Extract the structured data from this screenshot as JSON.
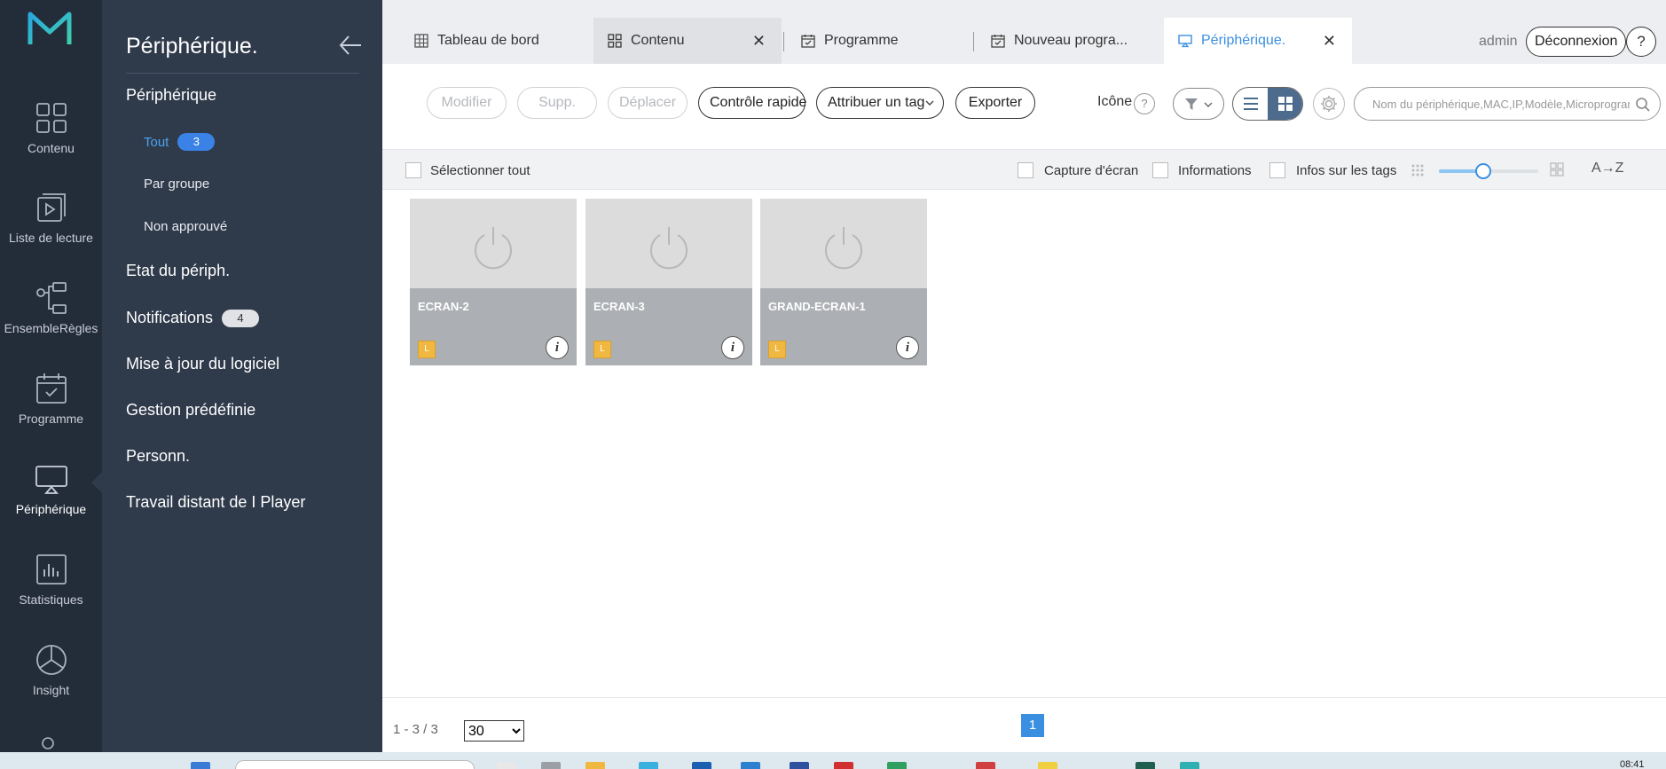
{
  "rail": {
    "items": [
      {
        "label": "Contenu",
        "icon": "content-grid-icon"
      },
      {
        "label": "Liste de lecture",
        "icon": "playlist-icon"
      },
      {
        "label": "EnsembleRègles",
        "icon": "ruleset-icon"
      },
      {
        "label": "Programme",
        "icon": "schedule-icon"
      },
      {
        "label": "Périphérique",
        "icon": "device-icon"
      },
      {
        "label": "Statistiques",
        "icon": "statistics-icon"
      },
      {
        "label": "Insight",
        "icon": "insight-icon"
      }
    ]
  },
  "sidebar": {
    "title": "Périphérique.",
    "section": "Périphérique",
    "sub_items": [
      {
        "label": "Tout",
        "count": "3"
      },
      {
        "label": "Par groupe"
      },
      {
        "label": "Non approuvé"
      }
    ],
    "items": [
      {
        "label": "Etat du périph."
      },
      {
        "label": "Notifications",
        "count": "4"
      },
      {
        "label": "Mise à jour du logiciel"
      },
      {
        "label": "Gestion prédéfinie"
      },
      {
        "label": "Personn."
      },
      {
        "label": "Travail distant de I Player"
      }
    ]
  },
  "tabs": [
    {
      "label": "Tableau de bord",
      "icon": "dashboard-icon"
    },
    {
      "label": "Contenu",
      "icon": "content-grid-icon",
      "close": "✕"
    },
    {
      "label": "Programme",
      "icon": "calendar-check-icon"
    },
    {
      "label": "Nouveau progra...",
      "icon": "calendar-check-icon"
    },
    {
      "label": "Périphérique.",
      "icon": "monitor-icon",
      "close": "✕"
    }
  ],
  "header": {
    "user": "admin",
    "logout_label": "Déconnexion",
    "help_label": "?"
  },
  "toolbar": {
    "modify": "Modifier",
    "delete": "Supp.",
    "move": "Déplacer",
    "quick_control": "Contrôle rapide",
    "assign_tag": "Attribuer un tag",
    "export": "Exporter",
    "icon_label": "Icône",
    "icon_help": "?",
    "search_placeholder": "Nom du périphérique,MAC,IP,Modèle,Microprogram"
  },
  "options": {
    "select_all": "Sélectionner tout",
    "screenshot": "Capture d'écran",
    "information": "Informations",
    "tag_info": "Infos sur les tags",
    "size_slider": 0.45,
    "sort_label": "A→Z"
  },
  "devices": [
    {
      "name": "ECRAN-2",
      "badge": "L",
      "info": "i"
    },
    {
      "name": "ECRAN-3",
      "badge": "L",
      "info": "i"
    },
    {
      "name": "GRAND-ECRAN-1",
      "badge": "L",
      "info": "i"
    }
  ],
  "footer": {
    "range": "1 - 3 / 3",
    "per_page": "30",
    "per_page_options": [
      "30"
    ],
    "current_page": "1"
  },
  "taskbar": {
    "time": "08:41"
  },
  "colors": {
    "rail_bg": "#232c39",
    "sidebar_bg": "#2f3a4b",
    "accent": "#3b8fe0",
    "badge": "#f0b840"
  }
}
